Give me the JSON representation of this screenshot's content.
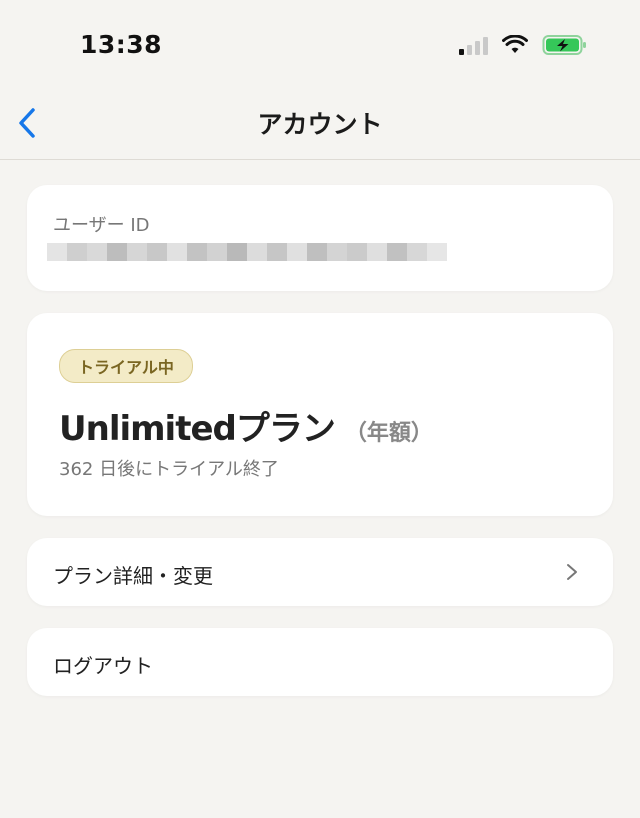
{
  "status_bar": {
    "time": "13:38"
  },
  "nav": {
    "title": "アカウント",
    "back_icon": "chevron-left-icon",
    "accent": "#1677e9"
  },
  "user": {
    "label": "ユーザー ID",
    "id_value": ""
  },
  "plan": {
    "badge": "トライアル中",
    "name": "Unlimitedプラン",
    "period": "（年額）",
    "remaining": "362 日後にトライアル終了"
  },
  "menu": {
    "plan_detail": "プラン詳細・変更",
    "logout": "ログアウト"
  },
  "colors": {
    "background": "#f5f4f1",
    "badge_bg": "#f3ebc7",
    "badge_text": "#7a6622",
    "battery": "#35c759"
  }
}
